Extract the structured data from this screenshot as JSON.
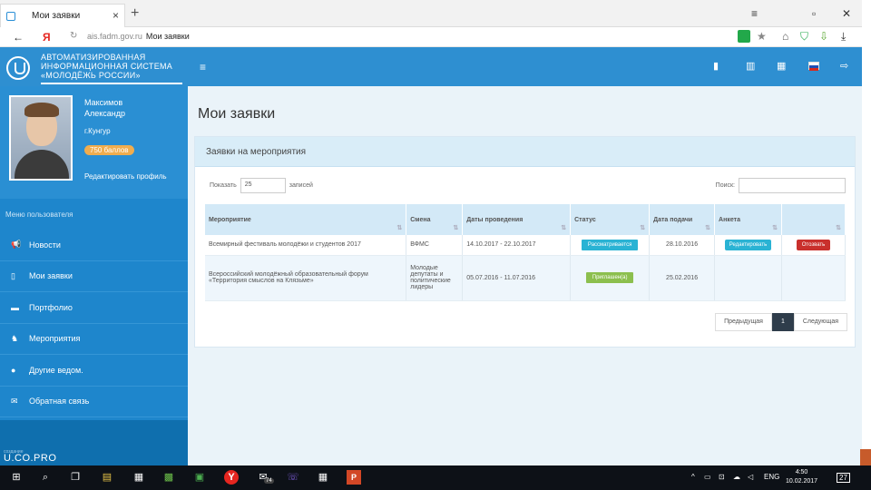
{
  "browser": {
    "tab_title": "Мои заявки",
    "tab_close": "×",
    "new_tab": "+",
    "back": "←",
    "yandex_logo": "Я",
    "reload": "↻",
    "url_domain": "ais.fadm.gov.ru",
    "url_page": "Мои заявки",
    "win_controls": [
      "≡",
      "▫",
      "✕"
    ],
    "ext_icons": [
      "★",
      "⌂",
      "⛉",
      "⇩",
      "⤓"
    ]
  },
  "header": {
    "logo_lines": [
      "АВТОМАТИЗИРОВАННАЯ",
      "ИНФОРМАЦИОННАЯ СИСТЕМА",
      "«МОЛОДЁЖЬ РОССИИ»"
    ],
    "menu_icon": "≡",
    "icons": [
      "▮",
      "▥",
      "▦",
      "⇨"
    ],
    "flag_colors": [
      "#ffffff",
      "#1e4fb5",
      "#d52b1e"
    ]
  },
  "profile": {
    "name_line1": "Максимов",
    "name_line2": "Александр",
    "city": "г.Кунгур",
    "points": "750 баллов",
    "edit_link": "Редактировать профиль"
  },
  "sidebar": {
    "title": "Меню пользователя",
    "items": [
      {
        "icon": "📢",
        "label": "Новости"
      },
      {
        "icon": "▯",
        "label": "Мои заявки"
      },
      {
        "icon": "▬",
        "label": "Портфолио"
      },
      {
        "icon": "♞",
        "label": "Мероприятия"
      },
      {
        "icon": "●",
        "label": "Другие ведом."
      },
      {
        "icon": "✉",
        "label": "Обратная связь"
      }
    ],
    "footer_small": "создание",
    "footer_brand": "U.CO.PRO"
  },
  "main": {
    "page_title": "Мои заявки",
    "card_title": "Заявки на мероприятия",
    "show_label": "Показать",
    "show_value": "25",
    "records_label": "записей",
    "search_label": "Поиск:",
    "columns": [
      "Мероприятие",
      "Смена",
      "Даты проведения",
      "Статус",
      "Дата подачи",
      "Анкета",
      ""
    ],
    "sort_glyph": "⇅",
    "rows": [
      {
        "event": "Всемирный фестиваль молодёжи и студентов 2017",
        "shift": "ВФМС",
        "dates": "14.10.2017 - 22.10.2017",
        "status": "Рассматривается",
        "status_color": "#2ab3d4",
        "submitted": "28.10.2016",
        "form_button": "Редактировать",
        "action_button": "Отозвать"
      },
      {
        "event": "Всероссийский молодёжный образовательный форум «Территория смыслов на Клязьме»",
        "shift": "Молодые депутаты и политические лидеры",
        "dates": "05.07.2016 - 11.07.2016",
        "status": "Приглашен(а)",
        "status_color": "#8cbf4e",
        "submitted": "25.02.2016",
        "form_button": "",
        "action_button": ""
      }
    ],
    "pager": {
      "prev": "Предыдущая",
      "page": "1",
      "next": "Следующая"
    }
  },
  "taskbar": {
    "icons": [
      "⊞",
      "⌕",
      "❐",
      "▤",
      "▦",
      "▩",
      "▣",
      "Y",
      "✉",
      "☏",
      "▦",
      "P"
    ],
    "mail_badge": "74",
    "tray": [
      "^",
      "▭",
      "⊡",
      "☁",
      "◁"
    ],
    "lang": "ENG",
    "time": "4:50",
    "date": "10.02.2017",
    "notif": "27"
  }
}
